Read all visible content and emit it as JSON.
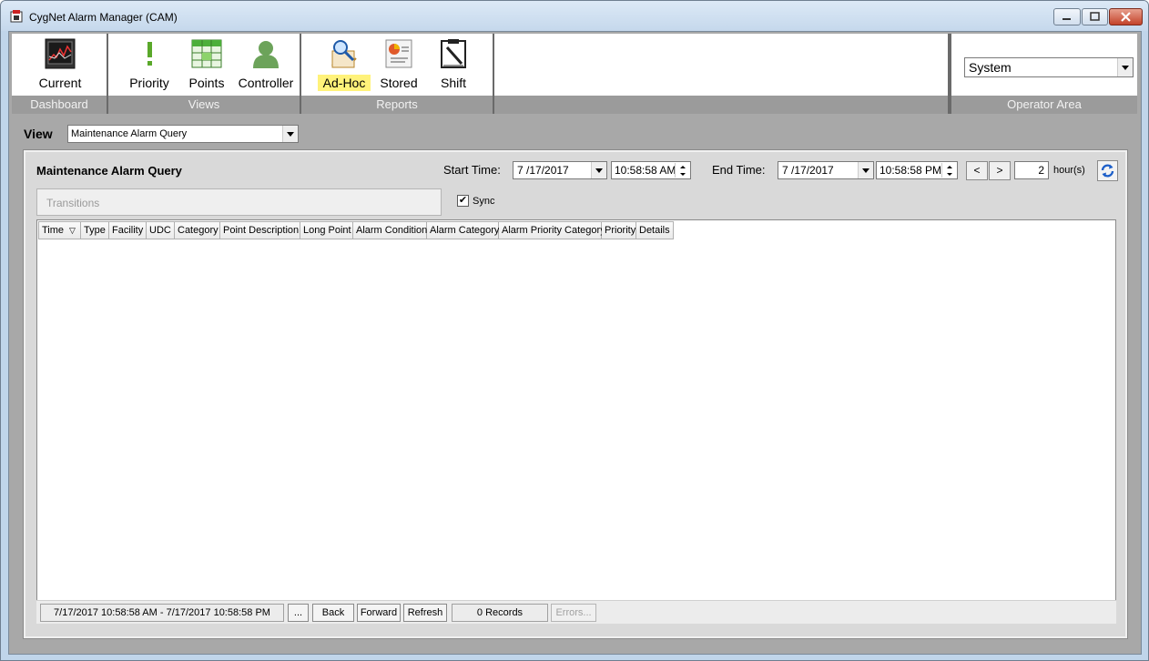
{
  "window": {
    "title": "CygNet Alarm Manager (CAM)"
  },
  "ribbon": {
    "groups": {
      "dashboard": {
        "label": "Dashboard",
        "buttons": [
          {
            "label": "Current",
            "icon": "chart-monitor-icon"
          }
        ]
      },
      "views": {
        "label": "Views",
        "buttons": [
          {
            "label": "Priority",
            "icon": "exclamation-icon"
          },
          {
            "label": "Points",
            "icon": "grid-table-icon"
          },
          {
            "label": "Controller",
            "icon": "user-icon"
          }
        ]
      },
      "reports": {
        "label": "Reports",
        "buttons": [
          {
            "label": "Ad-Hoc",
            "icon": "magnifier-map-icon",
            "active": true
          },
          {
            "label": "Stored",
            "icon": "report-document-icon"
          },
          {
            "label": "Shift",
            "icon": "clipboard-pen-icon"
          }
        ]
      },
      "operator": {
        "label": "Operator Area",
        "selected": "System"
      }
    }
  },
  "view": {
    "label": "View",
    "selected": "Maintenance Alarm Query"
  },
  "query": {
    "title": "Maintenance Alarm Query",
    "start_label": "Start Time:",
    "start_date": "7 /17/2017",
    "start_time": "10:58:58 AM",
    "end_label": "End Time:",
    "end_date": "7 /17/2017",
    "end_time": "10:58:58 PM",
    "prev_label": "<",
    "next_label": ">",
    "hours_value": "2",
    "hours_label": "hour(s)",
    "transitions_label": "Transitions",
    "sync_label": "Sync",
    "sync_checked": true
  },
  "grid": {
    "columns": [
      "Time",
      "Type",
      "Facility",
      "UDC",
      "Category",
      "Point Description",
      "Long Point",
      "Alarm Condition",
      "Alarm Category",
      "Alarm Priority Category",
      "Priority",
      "Details"
    ]
  },
  "status": {
    "range": "7/17/2017 10:58:58 AM - 7/17/2017 10:58:58 PM",
    "more_label": "...",
    "back_label": "Back",
    "forward_label": "Forward",
    "refresh_label": "Refresh",
    "records": "0 Records",
    "errors_label": "Errors..."
  },
  "colors": {
    "active_highlight": "#fff27a",
    "group_label_bg": "#9b9b9b",
    "panel_bg": "#d9d9d9"
  }
}
